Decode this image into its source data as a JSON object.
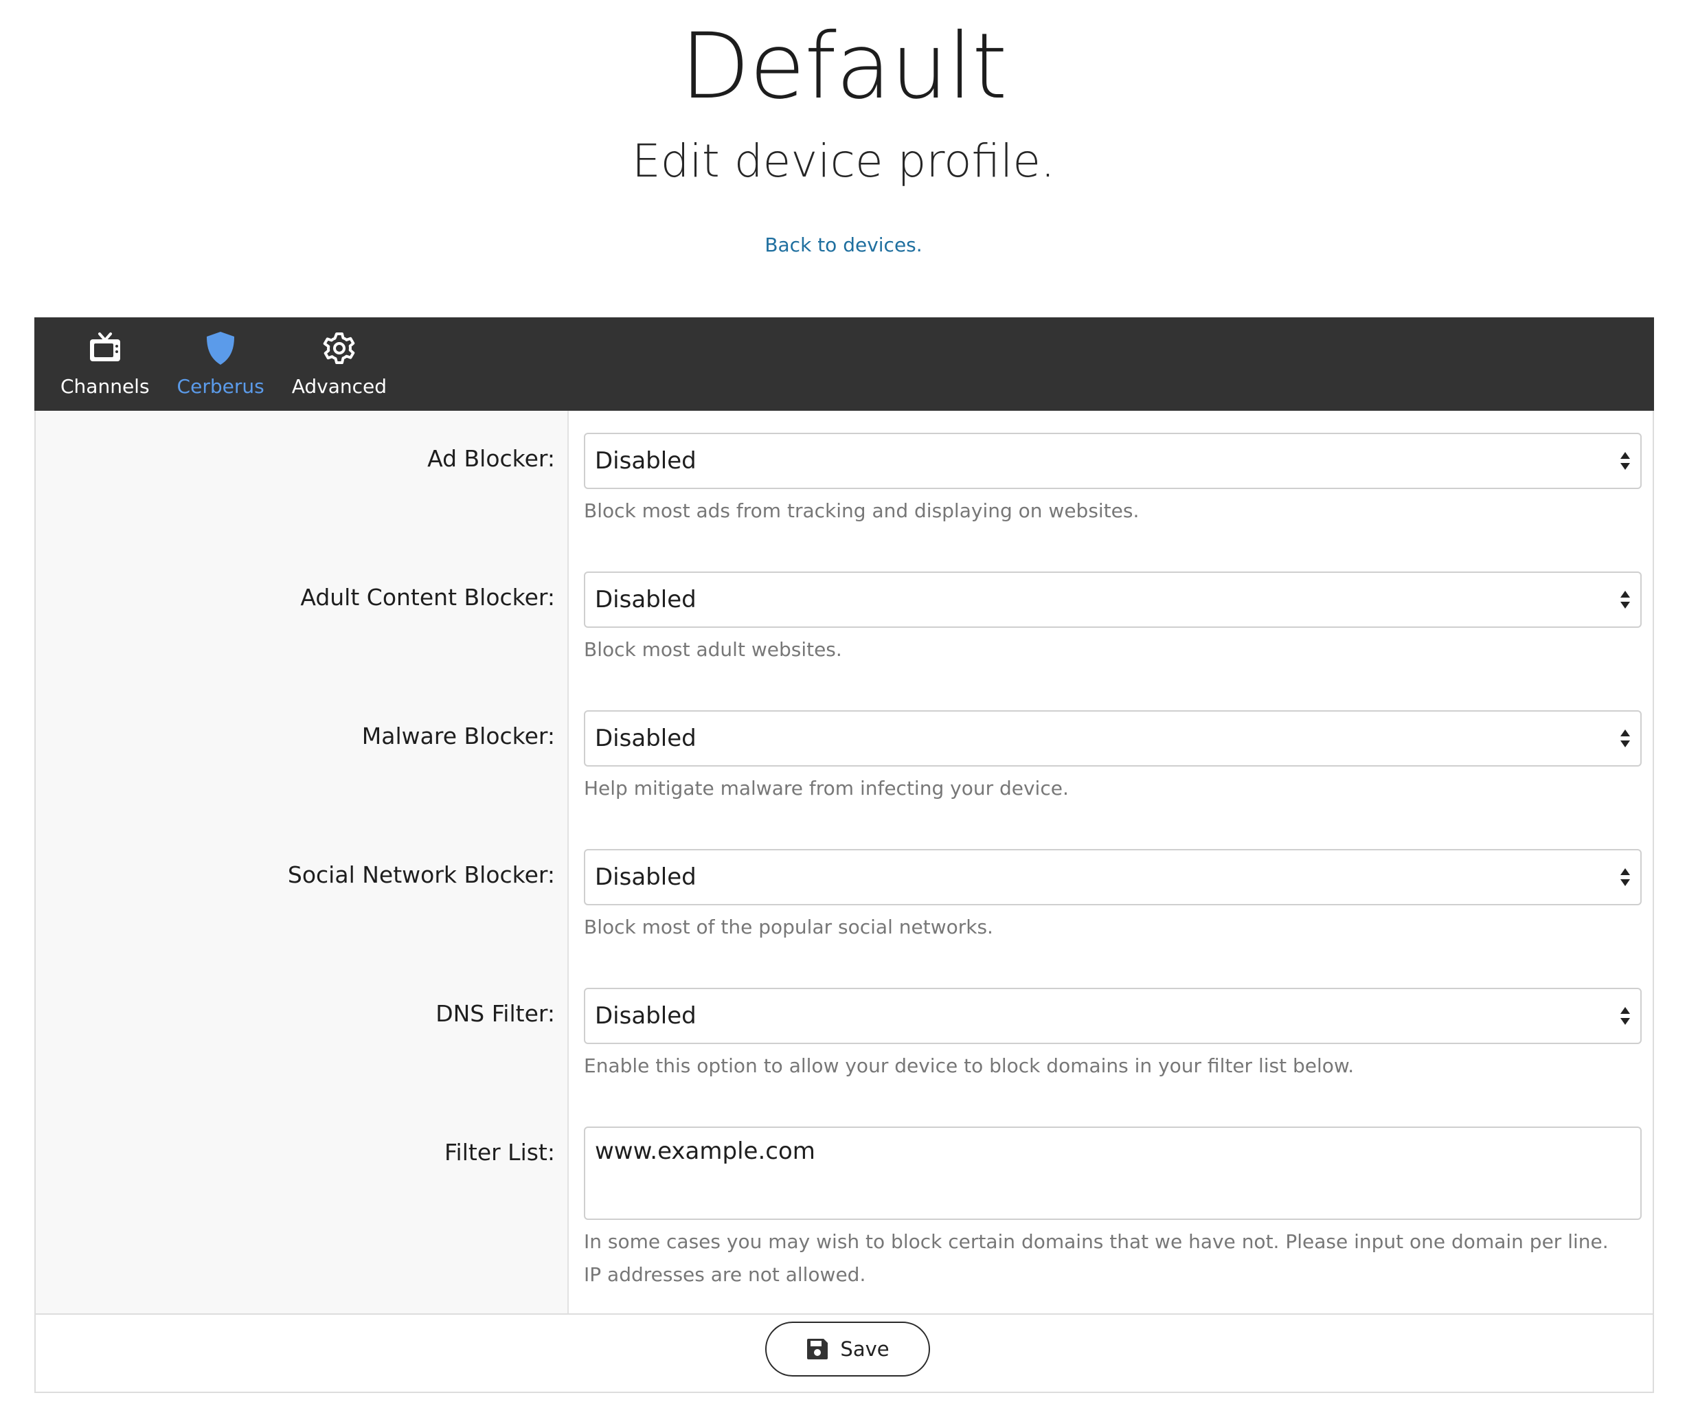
{
  "header": {
    "title": "Default",
    "subtitle": "Edit device profile.",
    "back_link": "Back to devices."
  },
  "tabs": [
    {
      "label": "Channels",
      "icon": "tv-icon",
      "active": false
    },
    {
      "label": "Cerberus",
      "icon": "shield-icon",
      "active": true
    },
    {
      "label": "Advanced",
      "icon": "gear-icon",
      "active": false
    }
  ],
  "colors": {
    "tabbar_bg": "#333333",
    "active_tab": "#5b9bea",
    "link": "#1f6f9f",
    "help_text": "#777777"
  },
  "fields": {
    "ad_blocker": {
      "label": "Ad Blocker:",
      "value": "Disabled",
      "help": "Block most ads from tracking and displaying on websites."
    },
    "adult_content_blocker": {
      "label": "Adult Content Blocker:",
      "value": "Disabled",
      "help": "Block most adult websites."
    },
    "malware_blocker": {
      "label": "Malware Blocker:",
      "value": "Disabled",
      "help": "Help mitigate malware from infecting your device."
    },
    "social_network_blocker": {
      "label": "Social Network Blocker:",
      "value": "Disabled",
      "help": "Block most of the popular social networks."
    },
    "dns_filter": {
      "label": "DNS Filter:",
      "value": "Disabled",
      "help": "Enable this option to allow your device to block domains in your filter list below."
    },
    "filter_list": {
      "label": "Filter List:",
      "value": "www.example.com",
      "help_line1": "In some cases you may wish to block certain domains that we have not. Please input one domain per line.",
      "help_line2": "IP addresses are not allowed."
    }
  },
  "footer": {
    "save_label": "Save",
    "save_icon": "floppy-disk-icon"
  }
}
